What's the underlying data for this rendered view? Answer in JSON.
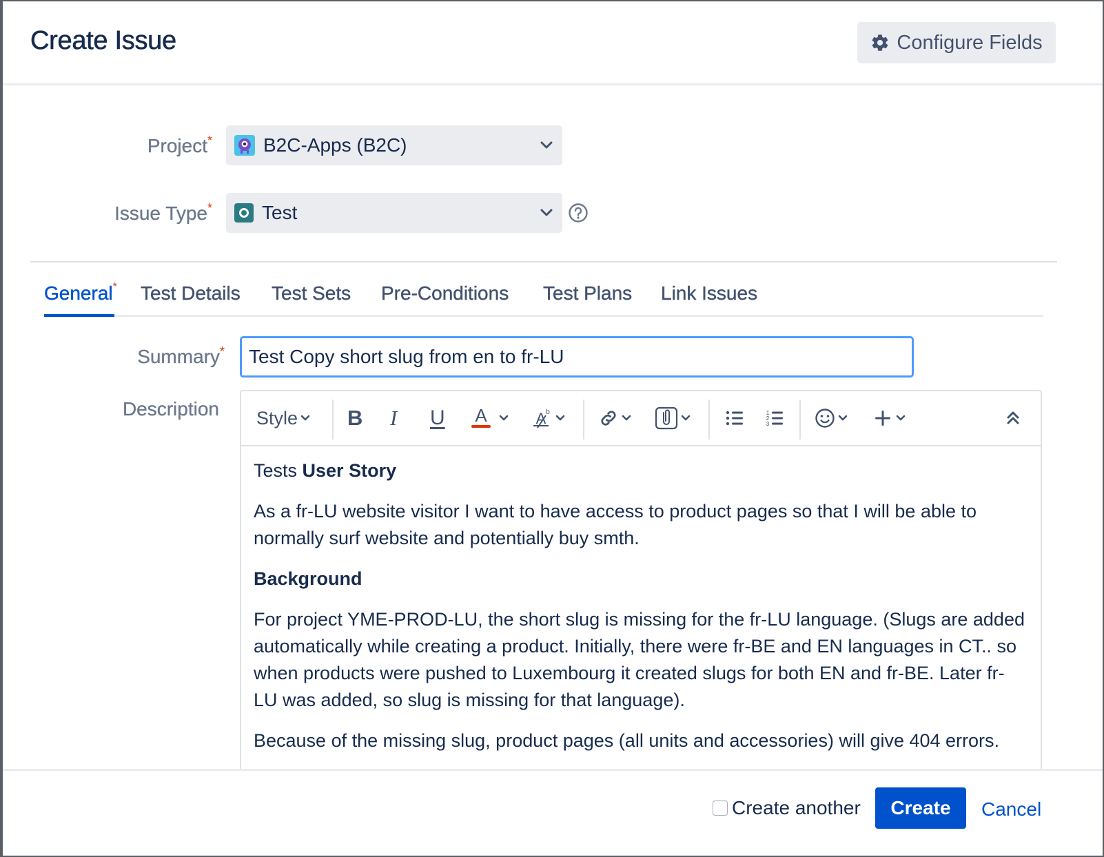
{
  "dialog": {
    "title": "Create Issue",
    "configure_fields_label": "Configure Fields"
  },
  "fields": {
    "project": {
      "label": "Project",
      "value": "B2C-Apps (B2C)"
    },
    "issue_type": {
      "label": "Issue Type",
      "value": "Test"
    },
    "summary": {
      "label": "Summary",
      "value": "Test Copy short slug from en to fr-LU"
    },
    "description": {
      "label": "Description"
    }
  },
  "tabs": [
    {
      "label": "General",
      "active": true
    },
    {
      "label": "Test Details"
    },
    {
      "label": "Test Sets"
    },
    {
      "label": "Pre-Conditions"
    },
    {
      "label": "Test Plans"
    },
    {
      "label": "Link Issues"
    }
  ],
  "toolbar": {
    "style_label": "Style",
    "icons": [
      "bold-icon",
      "italic-icon",
      "underline-icon",
      "text-color-icon",
      "text-format-icon",
      "link-icon",
      "attachment-icon",
      "bullet-list-icon",
      "numbered-list-icon",
      "emoji-icon",
      "plus-icon",
      "collapse-icon"
    ]
  },
  "description": {
    "p1_prefix": "Tests ",
    "p1_bold": "User Story",
    "p2": "As a fr-LU website visitor I want to have access to product pages so that I will be able to normally surf website and potentially buy smth.",
    "p3_bold": "Background",
    "p4": "For project YME-PROD-LU, the short slug is missing for the fr-LU language. (Slugs are added automatically while creating a product. Initially, there were fr-BE and EN languages in CT.. so when products were pushed to Luxembourg it created slugs for both EN and fr-BE. Later fr-LU was added, so slug is missing for that language).",
    "p5": "Because of the missing slug, product pages (all units and accessories) will give 404 errors."
  },
  "footer": {
    "create_another_label": "Create another",
    "create_another_checked": false,
    "create_label": "Create",
    "cancel_label": "Cancel"
  },
  "colors": {
    "primary": "#0052cc",
    "required": "#de350b",
    "focus_border": "#4c9aff",
    "text": "#172b4d",
    "label": "#6b778c"
  }
}
